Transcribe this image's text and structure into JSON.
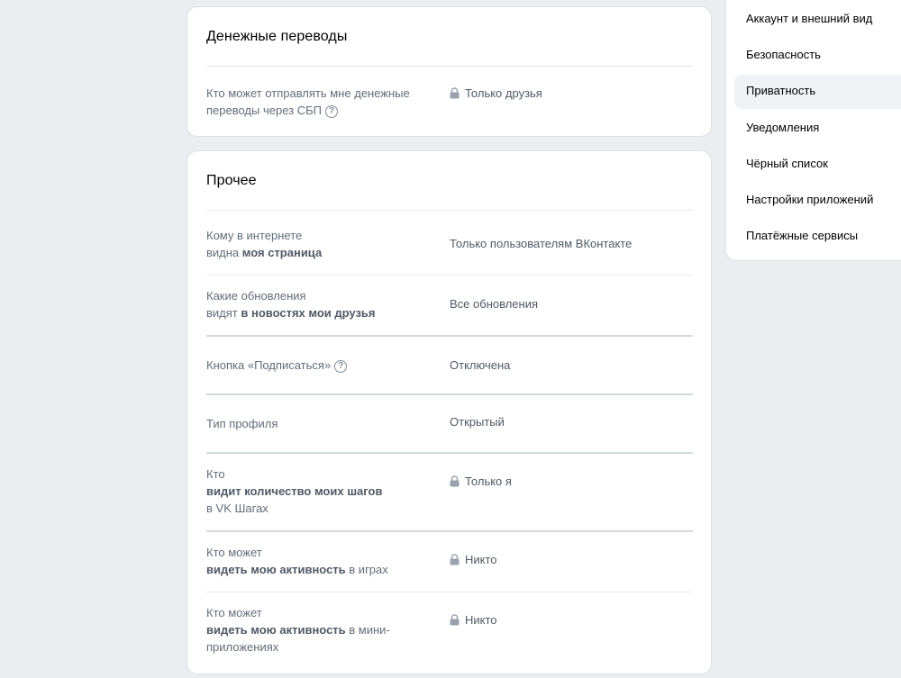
{
  "money_card": {
    "title": "Денежные переводы",
    "rows": [
      {
        "label": "Кто может отправлять мне денежные переводы через СБП",
        "value": "Только друзья",
        "locked": true,
        "help": "?"
      }
    ]
  },
  "other_card": {
    "title": "Прочее",
    "rows": [
      {
        "label_plain_1": "Кому в интернете",
        "label_plain_2": "видна ",
        "label_bold": "моя страница",
        "value": "Только пользователям ВКонтакте"
      },
      {
        "label_plain_1": "Какие обновления",
        "label_plain_2": "видят ",
        "label_bold": "в новостях мои друзья",
        "value": "Все обновления"
      },
      {
        "label_plain_1": "Кнопка «Подписаться»",
        "help": "?",
        "value": "Отключена"
      },
      {
        "label_plain_1": "Тип профиля",
        "value": "Открытый"
      },
      {
        "label_plain_1": "Кто",
        "label_bold": "видит количество моих шагов",
        "label_plain_2": "в VK Шагах",
        "value": "Только я",
        "locked": true
      },
      {
        "label_plain_1": "Кто может",
        "label_bold": "видеть мою активность",
        "label_plain_2": " в играх",
        "value": "Никто",
        "locked": true
      },
      {
        "label_plain_1": "Кто может",
        "label_bold": "видеть мою активность",
        "label_plain_2": " в мини-",
        "label_plain_3": "приложениях",
        "value": "Никто",
        "locked": true
      }
    ]
  },
  "nav": {
    "items": [
      {
        "label": "Аккаунт и внешний вид"
      },
      {
        "label": "Безопасность"
      },
      {
        "label": "Приватность",
        "active": true
      },
      {
        "label": "Уведомления"
      },
      {
        "label": "Чёрный список"
      },
      {
        "label": "Настройки приложений"
      },
      {
        "label": "Платёжные сервисы"
      }
    ]
  },
  "icons": {
    "lock": "lock-icon",
    "help": "question-circle-icon"
  },
  "colors": {
    "background": "#ebedf0",
    "card": "#ffffff",
    "label": "#626d7a",
    "value": "#4f5a66",
    "active_nav": "#f0f2f5"
  }
}
